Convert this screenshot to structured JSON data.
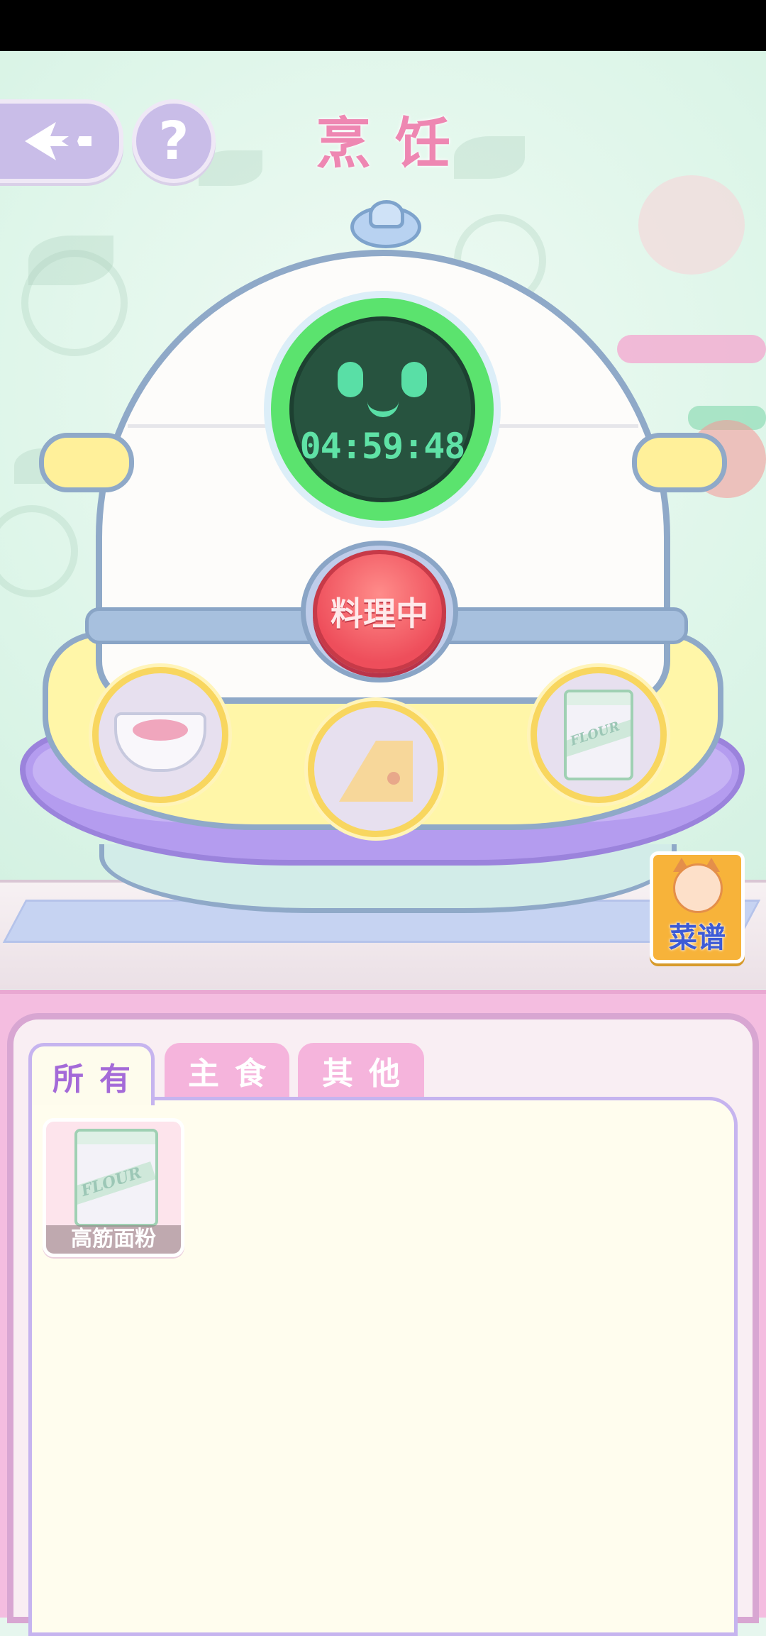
{
  "header": {
    "title": "烹饪",
    "help_label": "?"
  },
  "cooker": {
    "timer": "04:59:48",
    "status_button": "料理中",
    "slots": [
      {
        "icon": "dough-bowl-icon"
      },
      {
        "icon": "cheese-icon"
      },
      {
        "icon": "flour-bag-icon",
        "text": "FLOUR"
      }
    ]
  },
  "recipe_book": {
    "label": "菜谱"
  },
  "inventory": {
    "tabs": [
      {
        "label": "所有",
        "active": true
      },
      {
        "label": "主食",
        "active": false
      },
      {
        "label": "其他",
        "active": false
      }
    ],
    "items": [
      {
        "name": "高筋面粉",
        "icon": "flour-bag-icon",
        "bag_text": "FLOUR"
      }
    ]
  },
  "colors": {
    "title": "#ee87b2",
    "timer_ring": "#5be36e",
    "cook_button": "#ee4e5b",
    "panel": "#f4bde0",
    "active_tab_text": "#a46ad8"
  }
}
